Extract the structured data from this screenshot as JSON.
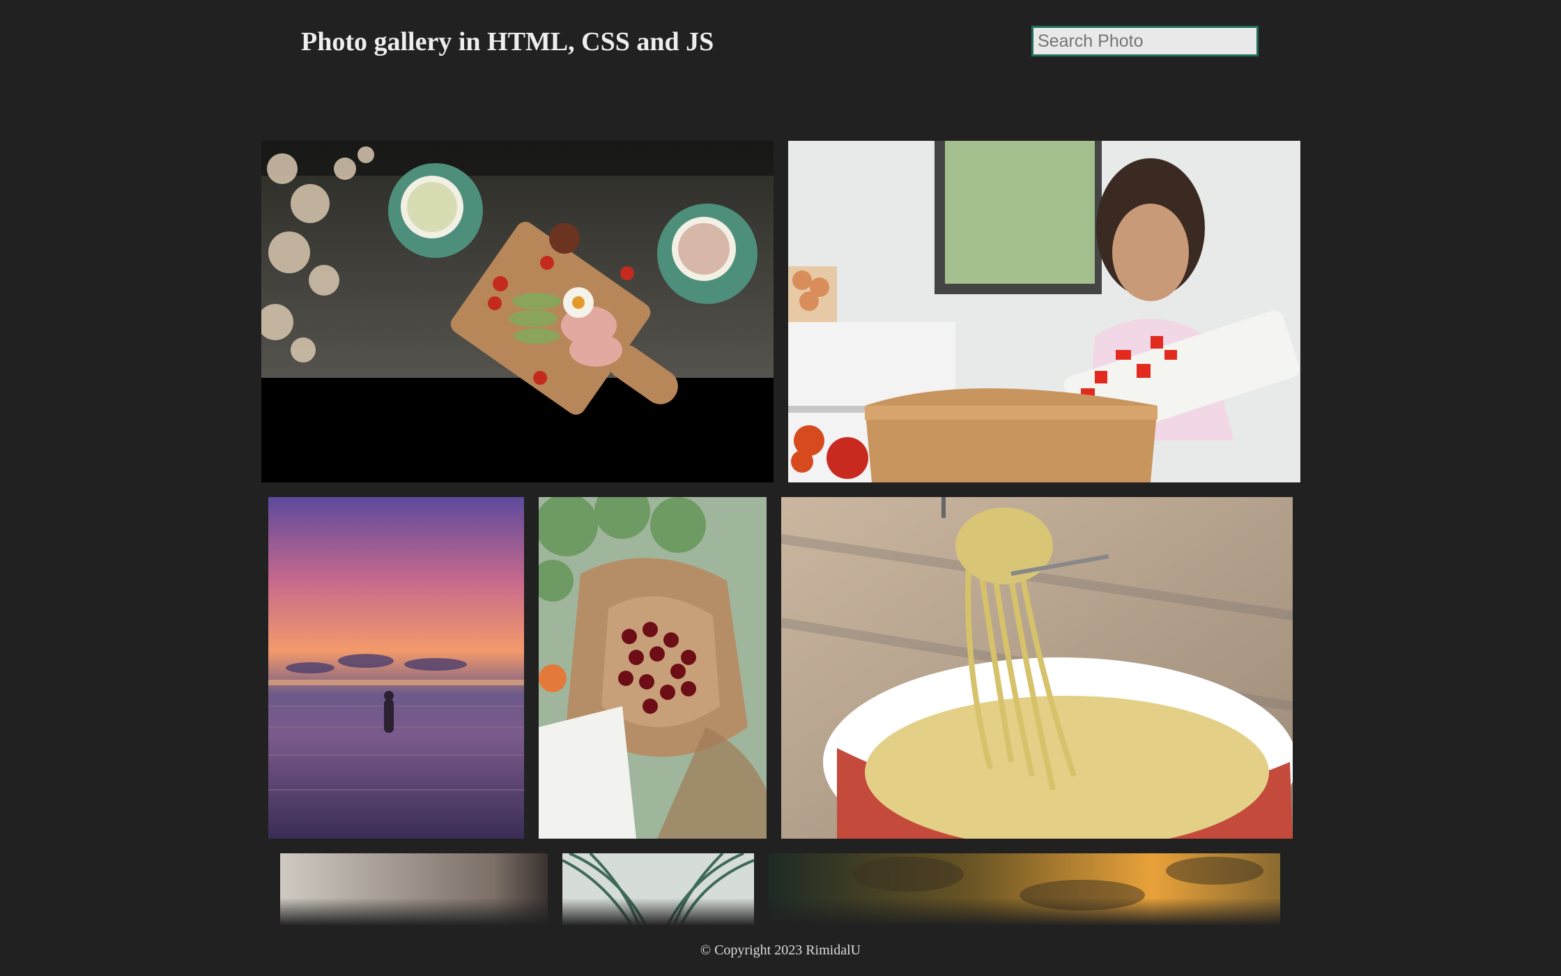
{
  "header": {
    "title": "Photo gallery in HTML, CSS and JS",
    "search_placeholder": "Search Photo"
  },
  "gallery": {
    "photos": [
      {
        "name": "breakfast-board"
      },
      {
        "name": "girl-cooking"
      },
      {
        "name": "sunset-sea"
      },
      {
        "name": "cherries-bag"
      },
      {
        "name": "pasta-fork"
      },
      {
        "name": "blurry-interior"
      },
      {
        "name": "palm-leaves"
      },
      {
        "name": "cloudy-sky"
      }
    ]
  },
  "footer": {
    "copyright": "© Copyright 2023 RimidalU"
  }
}
